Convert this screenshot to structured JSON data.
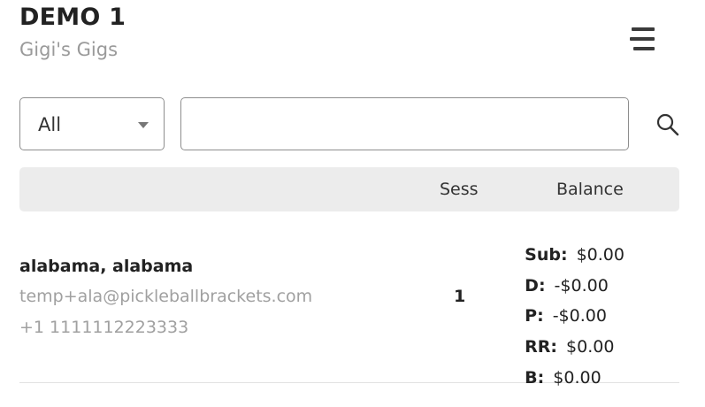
{
  "header": {
    "title": "DEMO 1",
    "subtitle": "Gigi's Gigs",
    "menu_icon": "hamburger-menu-icon"
  },
  "filters": {
    "status_value": "All",
    "search_value": "",
    "search_icon": "search-icon"
  },
  "table": {
    "columns": {
      "sess": "Sess",
      "balance": "Balance"
    },
    "rows": [
      {
        "name": "alabama, alabama",
        "email": "temp+ala@pickleballbrackets.com",
        "phone": "+1 1111112223333",
        "sess": "1",
        "balances": [
          {
            "label": "Sub:",
            "value": "$0.00"
          },
          {
            "label": "D:",
            "value": "-$0.00"
          },
          {
            "label": "P:",
            "value": "-$0.00"
          },
          {
            "label": "RR:",
            "value": "$0.00"
          },
          {
            "label": "B:",
            "value": "$0.00"
          }
        ]
      }
    ]
  }
}
